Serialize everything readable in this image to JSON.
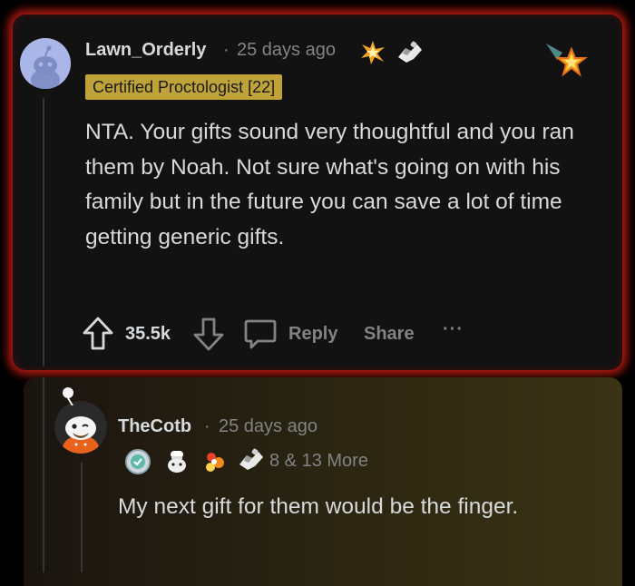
{
  "comment1": {
    "username": "Lawn_Orderly",
    "separator": "·",
    "time": "25 days ago",
    "awards": [
      "sparkle-burst-icon",
      "handshake-icon"
    ],
    "flair": "Certified Proctologist [22]",
    "body": "NTA. Your gifts sound very thoughtful and you ran them by Noah. Not sure what's going on with his family but in the future you can save a lot of time getting generic gifts.",
    "votes": "35.5k",
    "reply_label": "Reply",
    "share_label": "Share",
    "more_label": "···"
  },
  "comment2": {
    "username": "TheCotb",
    "separator": "·",
    "time": "25 days ago",
    "awards": [
      "wholesome-badge-icon",
      "chef-snoo-icon",
      "fire-flower-icon",
      "handshake-icon"
    ],
    "award_count": "8 & 13 More",
    "body": "My next gift for them would be the finger."
  },
  "colors": {
    "glow": "#d71e14",
    "flair_bg": "#bfa338",
    "text": "#d7dadc",
    "muted": "#818384"
  }
}
